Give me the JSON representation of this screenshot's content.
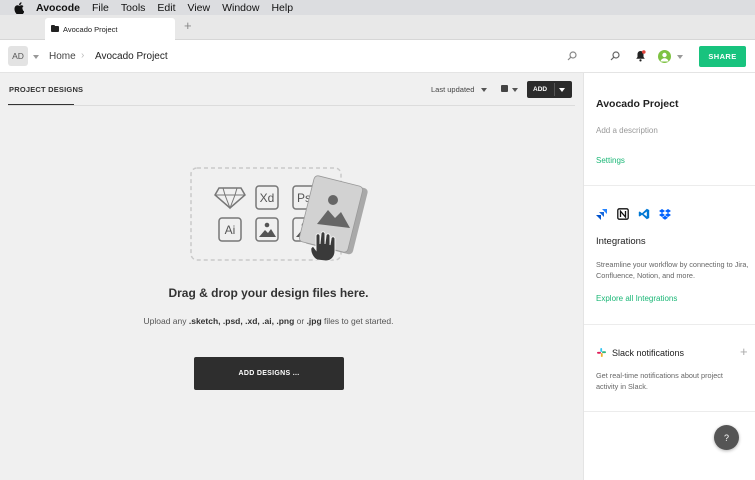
{
  "menubar": {
    "app_name": "Avocode",
    "items": [
      "File",
      "Tools",
      "Edit",
      "View",
      "Window",
      "Help"
    ]
  },
  "browser_tab": {
    "title": "Avocado Project",
    "new_tab_symbol": "+"
  },
  "header": {
    "avatar_initials": "AD",
    "breadcrumb": {
      "home": "Home",
      "separator": "›",
      "project": "Avocado Project"
    },
    "share_label": "SHARE"
  },
  "main": {
    "tab_label": "PROJECT DESIGNS",
    "sort_label": "Last updated",
    "add_label": "ADD",
    "file_type_icons": [
      "Xd",
      "Ps",
      "Ai"
    ],
    "drop_title": "Drag & drop your design files here.",
    "drop_sub": {
      "prefix": "Upload any ",
      "exts": [
        ".sketch,",
        ".psd,",
        ".xd,",
        ".ai,",
        ".png"
      ],
      "or": " or ",
      "last_ext": ".jpg",
      "suffix": " files to get started."
    },
    "add_designs_label": "ADD DESIGNS ..."
  },
  "sidebar": {
    "project_title": "Avocado Project",
    "description_placeholder": "Add a description",
    "settings_link": "Settings",
    "integrations_icons": [
      "jira-icon",
      "notion-icon",
      "vscode-icon",
      "dropbox-icon"
    ],
    "integrations_title": "Integrations",
    "integrations_text": "Streamline your workflow by connecting to Jira, Confluence, Notion, and more.",
    "integrations_link": "Explore all Integrations",
    "slack_title": "Slack notifications",
    "slack_add": "+",
    "slack_text": "Get real-time notifications about project activity in Slack."
  },
  "help_label": "?",
  "colors": {
    "accent_green": "#18c37e",
    "dark_button": "#2e2e2e",
    "link_green": "#1ab776"
  }
}
